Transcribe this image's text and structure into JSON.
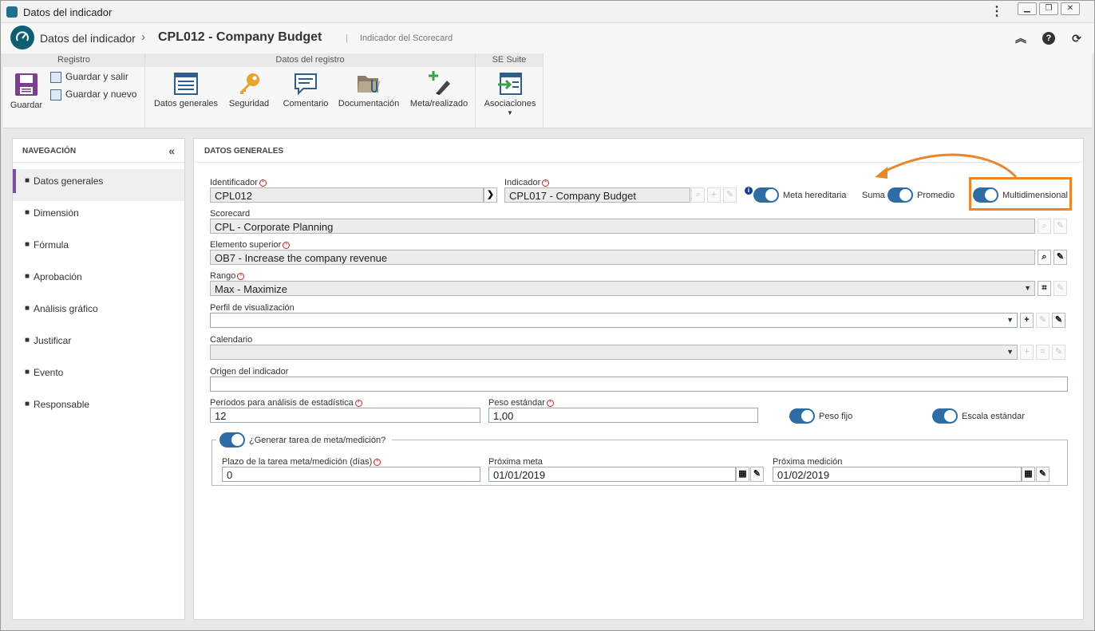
{
  "window": {
    "title": "Datos del indicador"
  },
  "header": {
    "breadcrumb_root": "Datos del indicador",
    "record_title": "CPL012 - Company Budget",
    "subtitle": "Indicador del Scorecard"
  },
  "ribbon": {
    "groups": [
      {
        "title": "Registro"
      },
      {
        "title": "Datos del registro"
      },
      {
        "title": "SE Suite"
      }
    ],
    "save": "Guardar",
    "save_exit": "Guardar y salir",
    "save_new": "Guardar y nuevo",
    "general_data": "Datos generales",
    "security": "Seguridad",
    "comment": "Comentario",
    "documentation": "Documentación",
    "goal_actual": "Meta/realizado",
    "associations": "Asociaciones"
  },
  "nav": {
    "title": "NAVEGACIÓN",
    "items": [
      {
        "label": "Datos generales"
      },
      {
        "label": "Dimensión"
      },
      {
        "label": "Fórmula"
      },
      {
        "label": "Aprobación"
      },
      {
        "label": "Análisis gráfico"
      },
      {
        "label": "Justificar"
      },
      {
        "label": "Evento"
      },
      {
        "label": "Responsable"
      }
    ]
  },
  "form": {
    "section_title": "DATOS GENERALES",
    "identifier_label": "Identificador",
    "identifier_value": "CPL012",
    "indicator_label": "Indicador",
    "indicator_value": "CPL017 - Company Budget",
    "hereditary_goal": "Meta hereditaria",
    "sum": "Suma",
    "average": "Promedio",
    "multidimensional": "Multidimensional",
    "scorecard_label": "Scorecard",
    "scorecard_value": "CPL - Corporate Planning",
    "parent_label": "Elemento superior",
    "parent_value": "OB7 - Increase the company revenue",
    "range_label": "Rango",
    "range_value": "Max - Maximize",
    "view_profile_label": "Perfil de visualización",
    "view_profile_value": "",
    "calendar_label": "Calendario",
    "calendar_value": "",
    "origin_label": "Origen del indicador",
    "origin_value": "",
    "periods_label": "Períodos para análisis de estadística",
    "periods_value": "12",
    "std_weight_label": "Peso estándar",
    "std_weight_value": "1,00",
    "fixed_weight": "Peso fijo",
    "std_scale": "Escala estándar",
    "generate_task": "¿Generar tarea de meta/medición?",
    "task_deadline_label": "Plazo de la tarea meta/medición (días)",
    "task_deadline_value": "0",
    "next_goal_label": "Próxima meta",
    "next_goal_value": "01/01/2019",
    "next_measure_label": "Próxima medición",
    "next_measure_value": "01/02/2019"
  },
  "colors": {
    "accent": "#2e6da4",
    "highlight": "#e8862e",
    "nav_active": "#7a4fa0"
  }
}
